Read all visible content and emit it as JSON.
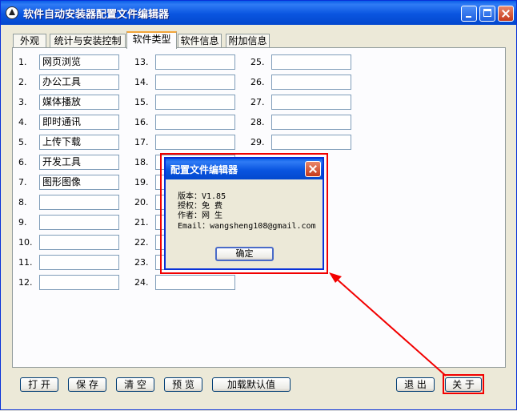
{
  "window": {
    "title": "软件自动安装器配置文件编辑器"
  },
  "tabs": [
    {
      "label": "外观"
    },
    {
      "label": "统计与安装控制"
    },
    {
      "label": "软件类型",
      "active": true
    },
    {
      "label": "软件信息"
    },
    {
      "label": "附加信息"
    }
  ],
  "columns": [
    {
      "rows": [
        {
          "num": "1.",
          "value": "网页浏览"
        },
        {
          "num": "2.",
          "value": "办公工具"
        },
        {
          "num": "3.",
          "value": "媒体播放"
        },
        {
          "num": "4.",
          "value": "即时通讯"
        },
        {
          "num": "5.",
          "value": "上传下载"
        },
        {
          "num": "6.",
          "value": "开发工具"
        },
        {
          "num": "7.",
          "value": "图形图像"
        },
        {
          "num": "8.",
          "value": ""
        },
        {
          "num": "9.",
          "value": ""
        },
        {
          "num": "10.",
          "value": ""
        },
        {
          "num": "11.",
          "value": ""
        },
        {
          "num": "12.",
          "value": ""
        }
      ]
    },
    {
      "rows": [
        {
          "num": "13.",
          "value": ""
        },
        {
          "num": "14.",
          "value": ""
        },
        {
          "num": "15.",
          "value": ""
        },
        {
          "num": "16.",
          "value": ""
        },
        {
          "num": "17.",
          "value": ""
        },
        {
          "num": "18.",
          "value": ""
        },
        {
          "num": "19.",
          "value": ""
        },
        {
          "num": "20.",
          "value": ""
        },
        {
          "num": "21.",
          "value": ""
        },
        {
          "num": "22.",
          "value": ""
        },
        {
          "num": "23.",
          "value": ""
        },
        {
          "num": "24.",
          "value": ""
        }
      ]
    },
    {
      "rows": [
        {
          "num": "25.",
          "value": ""
        },
        {
          "num": "26.",
          "value": ""
        },
        {
          "num": "27.",
          "value": ""
        },
        {
          "num": "28.",
          "value": ""
        },
        {
          "num": "29.",
          "value": ""
        }
      ]
    }
  ],
  "buttons": {
    "open": "打 开",
    "save": "保 存",
    "clear": "清 空",
    "preview": "预 览",
    "load_defaults": "加载默认值",
    "exit": "退 出",
    "about": "关 于"
  },
  "dialog": {
    "title": "配置文件编辑器",
    "version": "版本：V1.85",
    "license": "授权：免 费",
    "author": "作者：网 生",
    "email": "Email：wangsheng108@gmail.com",
    "ok": "确定"
  },
  "colors": {
    "annotation": "#F20000",
    "titlebar": "#0A55E0",
    "face": "#ECE9D8"
  }
}
